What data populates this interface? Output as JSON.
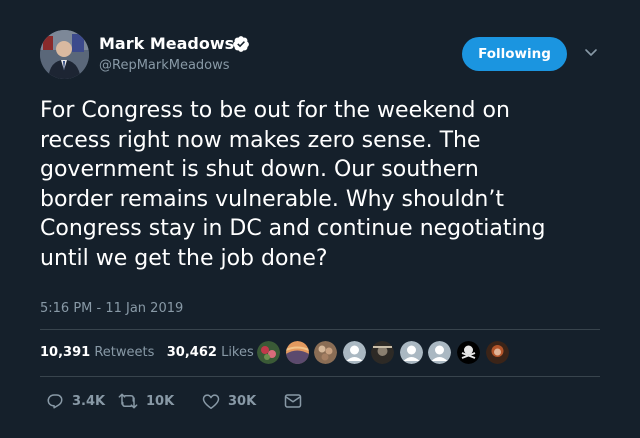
{
  "author": {
    "display_name": "Mark Meadows",
    "handle": "@RepMarkMeadows",
    "verified": true
  },
  "follow_button": {
    "label": "Following"
  },
  "tweet": {
    "lines": [
      "For Congress to be out for the weekend on",
      "recess right now makes zero sense. The",
      "government is shut down. Our southern",
      "border remains vulnerable. Why shouldn’t",
      "Congress stay in DC and continue negotiating",
      "until we get the job done?"
    ],
    "timestamp": "5:16 PM - 11 Jan 2019"
  },
  "stats": {
    "retweets_count": "10,391",
    "retweets_label": "Retweets",
    "likes_count": "30,462",
    "likes_label": "Likes"
  },
  "liker_avatars": [
    "liker-avatar-1",
    "liker-avatar-2",
    "liker-avatar-3",
    "liker-avatar-4",
    "liker-avatar-5",
    "liker-avatar-6",
    "liker-avatar-7",
    "liker-avatar-8",
    "liker-avatar-9"
  ],
  "actions": {
    "reply_count": "3.4K",
    "retweet_count": "10K",
    "like_count": "30K"
  },
  "colors": {
    "background": "#15202b",
    "accent": "#1b95e0",
    "muted_text": "#8899a6",
    "divider": "#38444d"
  },
  "icons": [
    "verified-badge-icon",
    "chevron-down-icon",
    "reply-icon",
    "retweet-icon",
    "like-icon",
    "direct-message-icon"
  ]
}
